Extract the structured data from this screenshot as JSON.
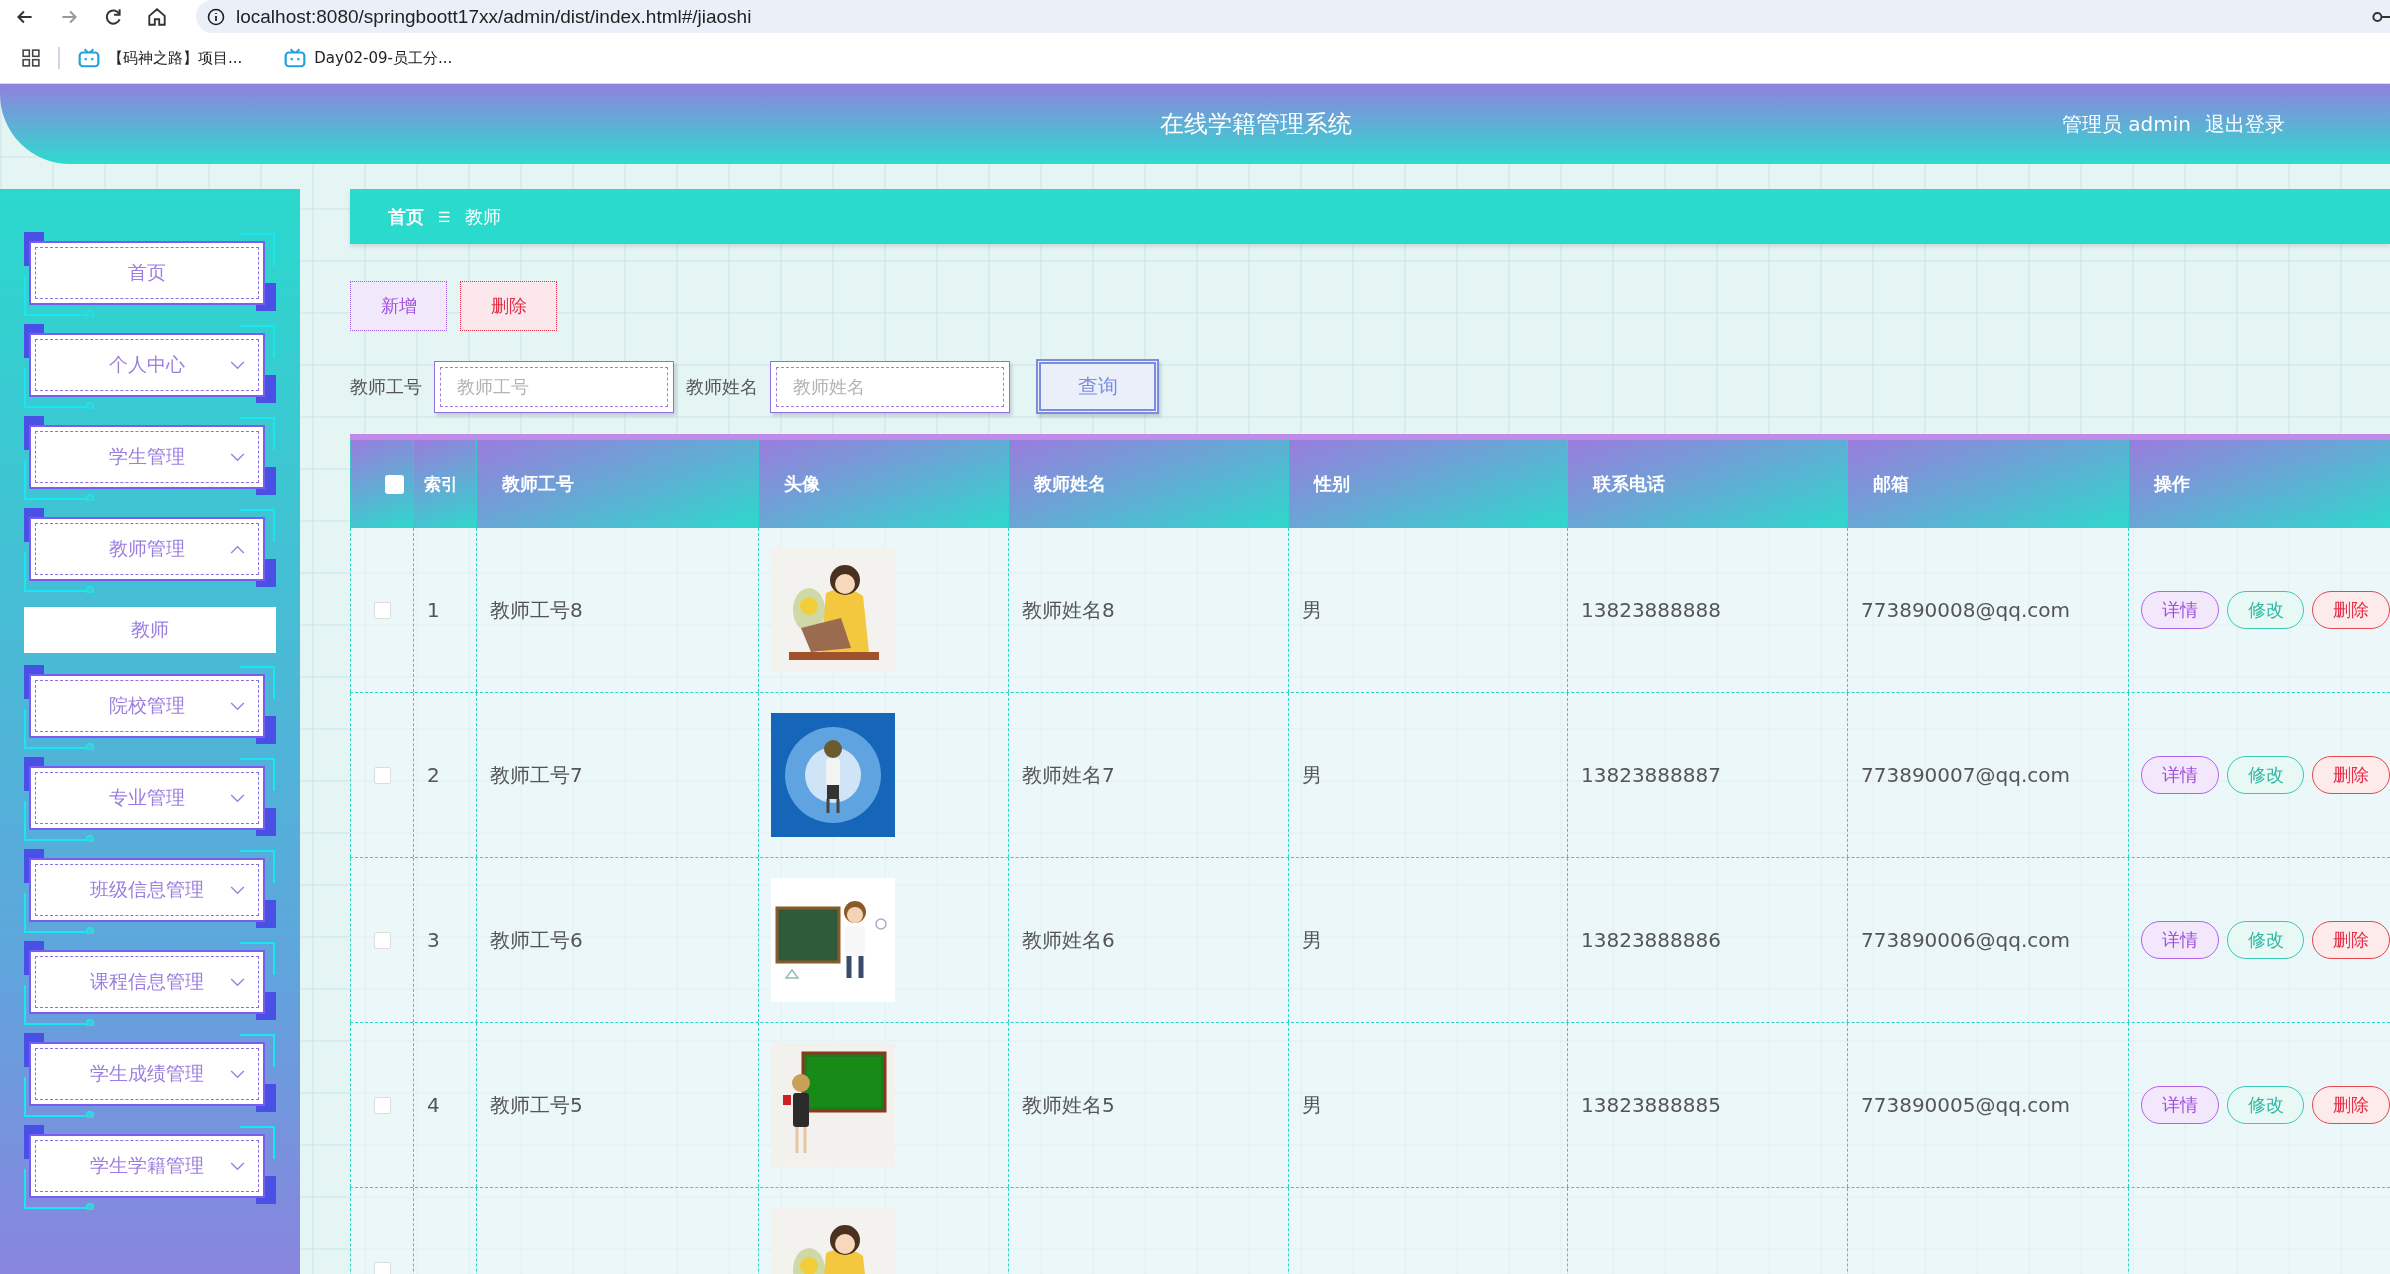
{
  "browser": {
    "url": "localhost:8080/springboott17xx/admin/dist/index.html#/jiaoshi",
    "bookmarks": [
      "【码神之路】项目...",
      "Day02-09-员工分..."
    ]
  },
  "header": {
    "title": "在线学籍管理系统",
    "user": "管理员 admin",
    "logout": "退出登录"
  },
  "sidebar": {
    "items": [
      {
        "label": "首页"
      },
      {
        "label": "个人中心",
        "expanded": false
      },
      {
        "label": "学生管理",
        "expanded": false
      },
      {
        "label": "教师管理",
        "expanded": true,
        "children": [
          {
            "label": "教师",
            "selected": true
          }
        ]
      },
      {
        "label": "院校管理",
        "expanded": false
      },
      {
        "label": "专业管理",
        "expanded": false
      },
      {
        "label": "班级信息管理",
        "expanded": false
      },
      {
        "label": "课程信息管理",
        "expanded": false
      },
      {
        "label": "学生成绩管理",
        "expanded": false
      },
      {
        "label": "学生学籍管理",
        "expanded": false
      }
    ]
  },
  "breadcrumb": {
    "home": "首页",
    "separator": "☰",
    "current": "教师"
  },
  "toolbar": {
    "add": "新增",
    "delete": "删除"
  },
  "search": {
    "fields": [
      {
        "label": "教师工号",
        "placeholder": "教师工号"
      },
      {
        "label": "教师姓名",
        "placeholder": "教师姓名"
      }
    ],
    "button": "查询"
  },
  "table": {
    "select_all": false,
    "columns": [
      "索引",
      "教师工号",
      "头像",
      "教师姓名",
      "性别",
      "联系电话",
      "邮箱",
      "操作"
    ],
    "rows": [
      {
        "selected": false,
        "index": "1",
        "id": "教师工号8",
        "name": "教师姓名8",
        "gender": "男",
        "phone": "13823888888",
        "email": "773890008@qq.com",
        "actions": [
          "详情",
          "修改",
          "删除"
        ]
      },
      {
        "selected": false,
        "index": "2",
        "id": "教师工号7",
        "name": "教师姓名7",
        "gender": "男",
        "phone": "13823888887",
        "email": "773890007@qq.com",
        "actions": [
          "详情",
          "修改",
          "删除"
        ]
      },
      {
        "selected": false,
        "index": "3",
        "id": "教师工号6",
        "name": "教师姓名6",
        "gender": "男",
        "phone": "13823888886",
        "email": "773890006@qq.com",
        "actions": [
          "详情",
          "修改",
          "删除"
        ]
      },
      {
        "selected": false,
        "index": "4",
        "id": "教师工号5",
        "name": "教师姓名5",
        "gender": "男",
        "phone": "13823888885",
        "email": "773890005@qq.com",
        "actions": [
          "详情",
          "修改",
          "删除"
        ]
      },
      {
        "selected": false
      }
    ]
  }
}
